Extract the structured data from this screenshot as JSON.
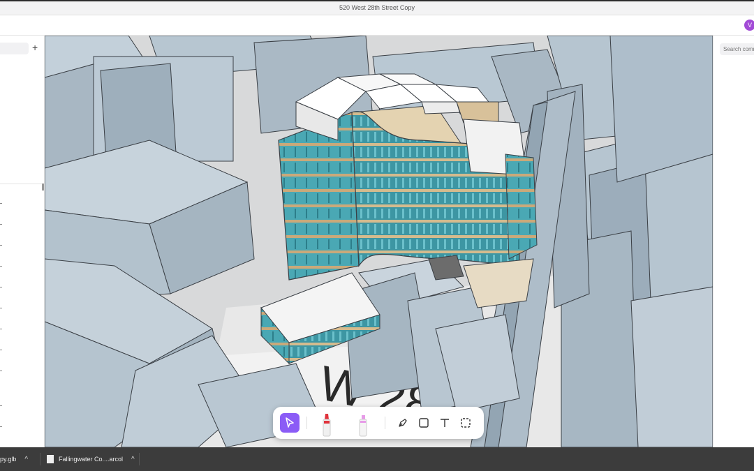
{
  "window": {
    "title": "520 West 28th Street Copy"
  },
  "user": {
    "avatar_initial": "V",
    "avatar_color": "#a24bd6"
  },
  "left_panel": {
    "add_label": "+"
  },
  "comments": {
    "search_placeholder": "Search comm"
  },
  "drawing_toolbar": {
    "tools": [
      {
        "name": "select",
        "icon": "cursor-arrow-icon",
        "active": true
      },
      {
        "name": "marker",
        "icon": "red-marker-icon",
        "active": false
      },
      {
        "name": "highlighter",
        "icon": "pink-highlighter-icon",
        "active": false
      },
      {
        "name": "pen",
        "icon": "pen-nib-icon",
        "active": false
      },
      {
        "name": "rectangle",
        "icon": "square-icon",
        "active": false
      },
      {
        "name": "text",
        "icon": "text-T-icon",
        "active": false
      },
      {
        "name": "area-select",
        "icon": "dashed-square-icon",
        "active": false
      }
    ],
    "accent_color": "#8b5cf6"
  },
  "downloads": [
    {
      "name": "py.glb",
      "chevron": "^"
    },
    {
      "name": "Fallingwater Co....arcol",
      "chevron": "^"
    }
  ],
  "colors": {
    "context_buildings": "#b4c3cf",
    "facade_glass": "#47a3b0",
    "slab_edge": "#d9c6a2"
  }
}
